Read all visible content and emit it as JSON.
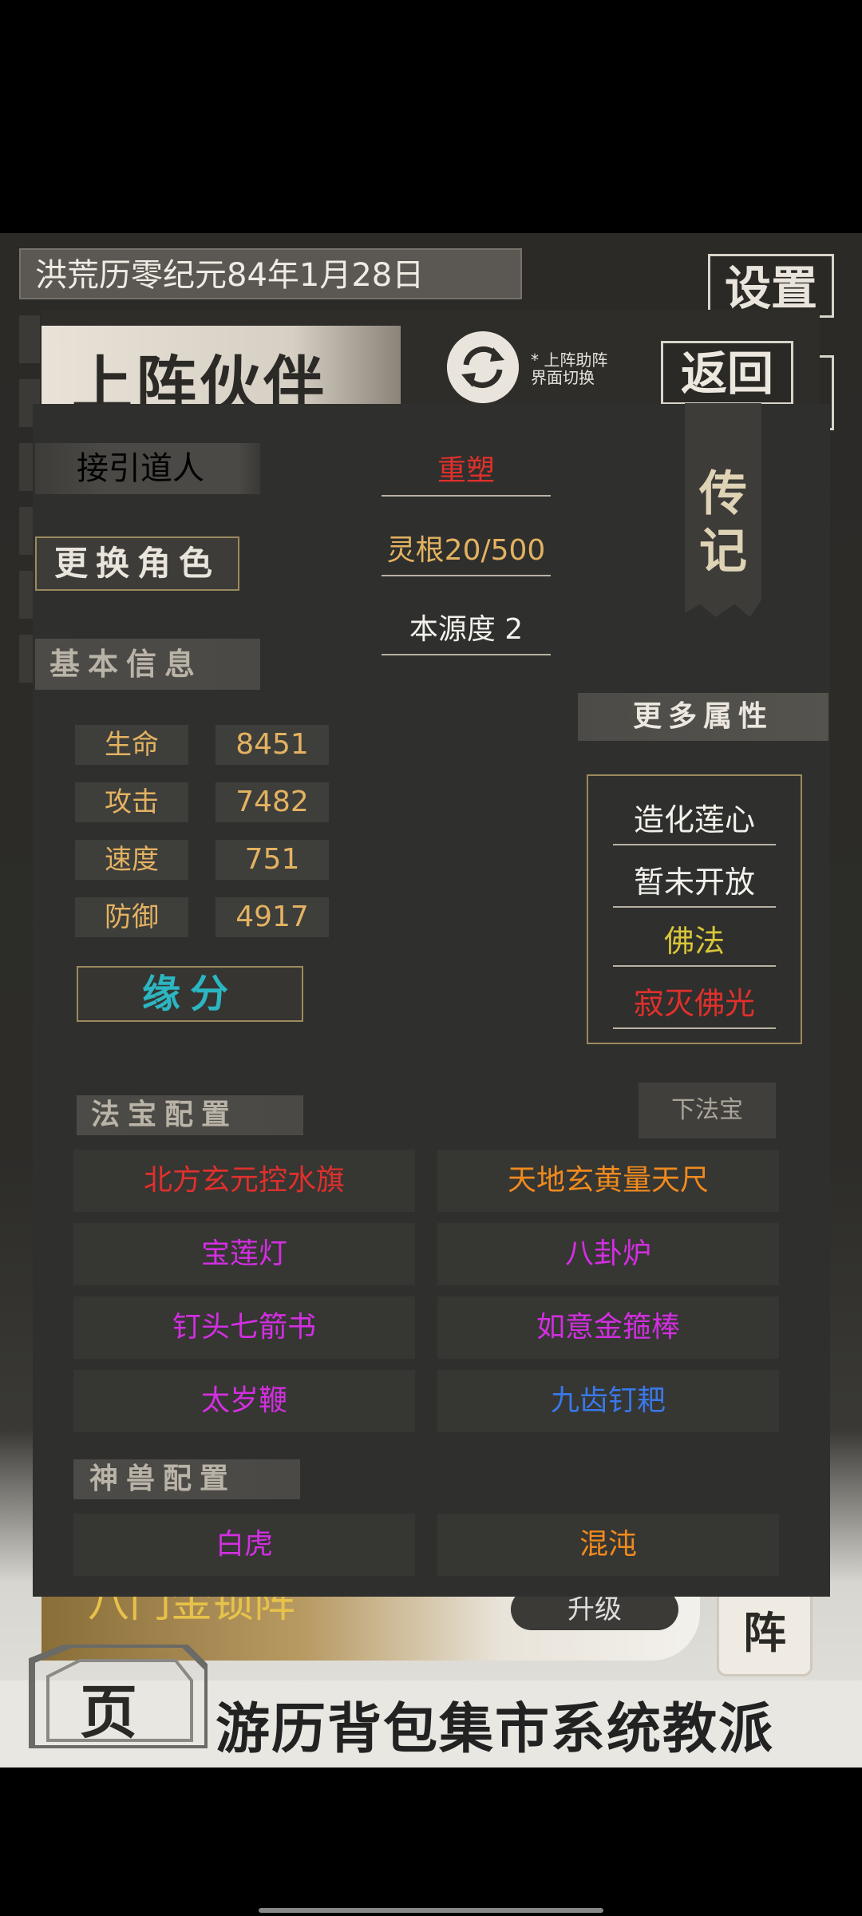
{
  "status": {
    "date": "洪荒历零纪元84年1月28日"
  },
  "settings_label": "设置",
  "bottom": {
    "card_title": "八门金锁阵",
    "upgrade_label": "升级",
    "formation_label": "阵",
    "deco_label": "页",
    "nav": "游历背包集市系统教派"
  },
  "partner": {
    "title": "上阵伙伴",
    "swap_note": "* 上阵助阵界面切换",
    "back_label": "返回"
  },
  "character": {
    "name": "接引道人",
    "change_role_label": "更换角色",
    "reshape_label": "重塑",
    "spirit_root": "灵根20/500",
    "origin_degree": "本源度 2",
    "biography_label": "传记"
  },
  "basic_info": {
    "label": "基本信息",
    "stats": [
      {
        "label": "生命",
        "value": "8451"
      },
      {
        "label": "攻击",
        "value": "7482"
      },
      {
        "label": "速度",
        "value": "751"
      },
      {
        "label": "防御",
        "value": "4917"
      }
    ],
    "fate_label": "缘分"
  },
  "more_attributes": {
    "label": "更多属性",
    "items": [
      {
        "text": "造化莲心",
        "color": "#f3f1ec"
      },
      {
        "text": "暂未开放",
        "color": "#f3f1ec"
      },
      {
        "text": "佛法",
        "color": "#d7c63a"
      },
      {
        "text": "寂灭佛光",
        "color": "#e0302c"
      }
    ]
  },
  "treasures": {
    "label": "法宝配置",
    "unequip_label": "下法宝",
    "slots": [
      {
        "name": "北方玄元控水旗",
        "color": "#e0302c"
      },
      {
        "name": "天地玄黄量天尺",
        "color": "#f08a1e"
      },
      {
        "name": "宝莲灯",
        "color": "#d22fe0"
      },
      {
        "name": "八卦炉",
        "color": "#d22fe0"
      },
      {
        "name": "钉头七箭书",
        "color": "#d22fe0"
      },
      {
        "name": "如意金箍棒",
        "color": "#d22fe0"
      },
      {
        "name": "太岁鞭",
        "color": "#d22fe0"
      },
      {
        "name": "九齿钉耙",
        "color": "#3a78e8"
      }
    ]
  },
  "beasts": {
    "label": "神兽配置",
    "slots": [
      {
        "name": "白虎",
        "color": "#d22fe0"
      },
      {
        "name": "混沌",
        "color": "#f08a1e"
      }
    ]
  }
}
